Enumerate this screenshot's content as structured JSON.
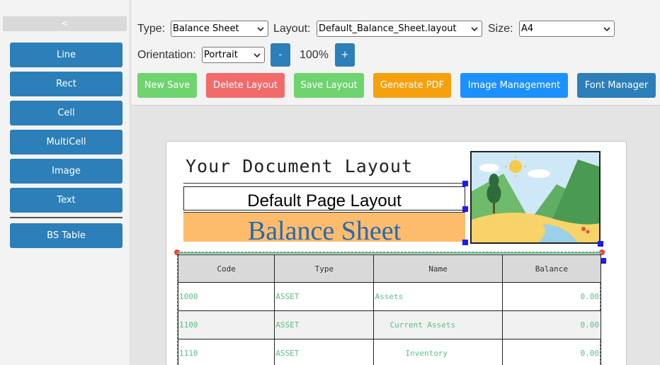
{
  "sidebar": {
    "collapse_label": "<",
    "tools": [
      "Line",
      "Rect",
      "Cell",
      "MultiCell",
      "Image",
      "Text"
    ],
    "bs_table_label": "BS Table"
  },
  "toolbar": {
    "type_label": "Type:",
    "type_value": "Balance Sheet",
    "layout_label": "Layout:",
    "layout_value": "Default_Balance_Sheet.layout",
    "size_label": "Size:",
    "size_value": "A4",
    "orientation_label": "Orientation:",
    "orientation_value": "Portrait",
    "zoom_minus": "-",
    "zoom_value": "100%",
    "zoom_plus": "+",
    "actions": {
      "new_save": "New Save",
      "delete_layout": "Delete Layout",
      "save_layout": "Save Layout",
      "generate_pdf": "Generate PDF",
      "image_management": "Image Management",
      "font_manager": "Font Manager"
    }
  },
  "colors": {
    "tool_blue": "#2c7fb8",
    "new_save": "#6fd46f",
    "delete": "#f26b6b",
    "save_layout": "#6fd46f",
    "generate_pdf": "#f5a10f",
    "image_management": "#1d90ff",
    "font_manager": "#2c7fb8",
    "title_blue": "#2668b3",
    "sheet_orange": "#fdbc6c",
    "table_text_green": "#5bbf85"
  },
  "document": {
    "title": "Your Document Layout",
    "page_layout_text": "Default Page Layout",
    "sheet_title": "Balance Sheet",
    "image_icon": "landscape-placeholder-icon"
  },
  "table": {
    "headers": [
      "Code",
      "Type",
      "Name",
      "Balance"
    ],
    "rows": [
      {
        "code": "1000",
        "type": "ASSET",
        "name": "Assets",
        "balance": "0.00"
      },
      {
        "code": "1100",
        "type": "ASSET",
        "name": "Current Assets",
        "balance": "0.00"
      },
      {
        "code": "1110",
        "type": "ASSET",
        "name": "Inventory",
        "balance": "0.00"
      }
    ]
  }
}
